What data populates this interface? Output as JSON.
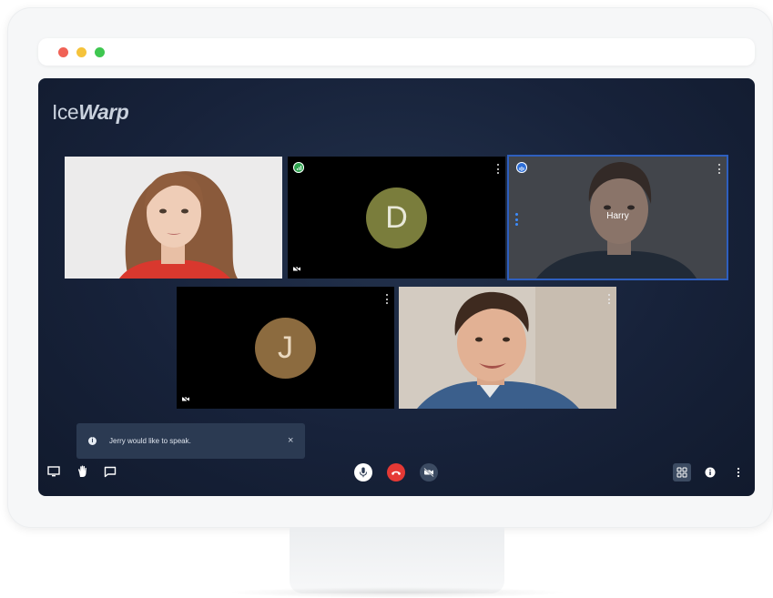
{
  "app": {
    "logo_text_a": "Ice",
    "logo_text_b": "Warp"
  },
  "colors": {
    "screen_bg": "#17223a",
    "active_tile_border": "#2e5fbf",
    "hangup": "#e53935",
    "toast_bg": "#2b3a52"
  },
  "participants": [
    {
      "kind": "video",
      "icon": "person-video"
    },
    {
      "kind": "avatar",
      "initial": "D",
      "color": "#7a7d3c",
      "badge": "signal-icon",
      "camera_off": true
    },
    {
      "kind": "video",
      "name": "Harry",
      "active_speaker": true,
      "badge": "speaker-icon"
    },
    {
      "kind": "avatar",
      "initial": "J",
      "color": "#8c6b3f",
      "camera_off": true
    },
    {
      "kind": "video",
      "icon": "person-video"
    }
  ],
  "notification": {
    "message": "Jerry would like to speak.",
    "close_glyph": "×"
  },
  "toolbar": {
    "left": [
      "screen-share-icon",
      "raise-hand-icon",
      "chat-icon"
    ],
    "center": [
      "microphone-icon",
      "hang-up-icon",
      "camera-off-icon"
    ],
    "right": [
      "grid-layout-icon",
      "info-icon",
      "more-vertical-icon"
    ]
  }
}
